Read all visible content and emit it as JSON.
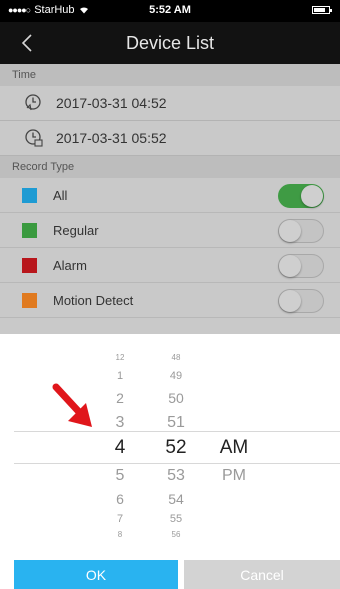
{
  "status_bar": {
    "carrier": "StarHub",
    "signal_dots": "●●●●○",
    "time": "5:52 AM"
  },
  "nav": {
    "title": "Device List"
  },
  "time_section": {
    "header": "Time",
    "start": "2017-03-31 04:52",
    "end": "2017-03-31 05:52"
  },
  "record_section": {
    "header": "Record Type",
    "items": [
      {
        "label": "All",
        "color": "#1e9bd3",
        "on": true
      },
      {
        "label": "Regular",
        "color": "#3a9a3f",
        "on": false
      },
      {
        "label": "Alarm",
        "color": "#b8161c",
        "on": false
      },
      {
        "label": "Motion Detect",
        "color": "#e07a1f",
        "on": false
      }
    ]
  },
  "picker": {
    "hours": [
      "12",
      "1",
      "2",
      "3",
      "4",
      "5",
      "6",
      "7",
      "8"
    ],
    "minutes": [
      "48",
      "49",
      "50",
      "51",
      "52",
      "53",
      "54",
      "55",
      "56"
    ],
    "ampm": [
      "AM",
      "PM"
    ],
    "selected": {
      "hour": "4",
      "minute": "52",
      "ampm": "AM"
    }
  },
  "buttons": {
    "ok": "OK",
    "cancel": "Cancel"
  },
  "colors": {
    "ok": "#29b3f0",
    "toggle_on": "#3f9b44",
    "arrow": "#e0161b"
  }
}
